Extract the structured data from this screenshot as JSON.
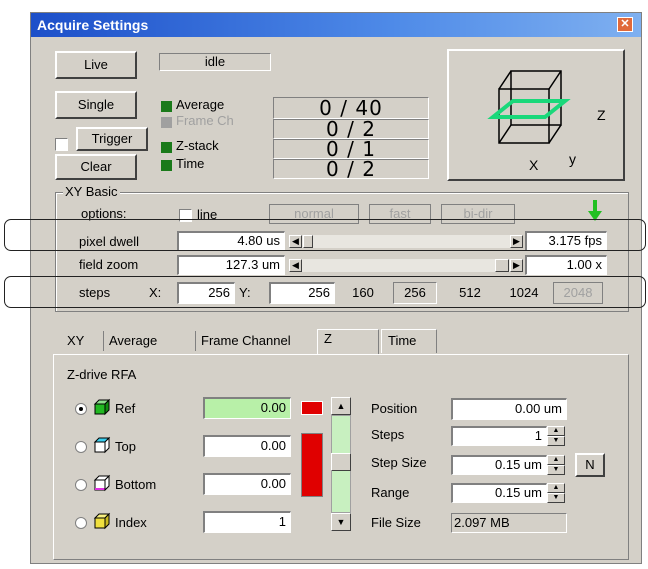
{
  "window": {
    "title": "Acquire Settings",
    "close_glyph": "✕"
  },
  "acquire": {
    "live_label": "Live",
    "single_label": "Single",
    "trigger_label": "Trigger",
    "clear_label": "Clear",
    "status": "idle",
    "counters": [
      {
        "label": "Average",
        "value": "0 / 40",
        "color": "#1a7a1a",
        "enabled": true
      },
      {
        "label": "Frame Ch",
        "value": "0 / 2",
        "color": "#a0a0a0",
        "enabled": false
      },
      {
        "label": "Z-stack",
        "value": "0 / 1",
        "color": "#1a7a1a",
        "enabled": true
      },
      {
        "label": "Time",
        "value": "0 / 2",
        "color": "#1a7a1a",
        "enabled": true
      }
    ]
  },
  "axes_diagram": {
    "x": "X",
    "y": "y",
    "z": "Z"
  },
  "xy_basic": {
    "group_label": "XY Basic",
    "options_label": "options:",
    "line_label": "line",
    "normal_label": "normal",
    "fast_label": "fast",
    "bi_dir_label": "bi-dir",
    "pixel_dwell_label": "pixel dwell",
    "pixel_dwell_value": "4.80 us",
    "fps_value": "3.175 fps",
    "field_zoom_label": "field zoom",
    "field_zoom_value": "127.3 um",
    "zoom_factor": "1.00 x",
    "steps_label": "steps",
    "x_label": "X:",
    "x_value": "256",
    "y_label": "Y:",
    "y_value": "256",
    "step_presets": [
      "160",
      "256",
      "512",
      "1024",
      "2048"
    ]
  },
  "tabs": [
    "XY",
    "Average",
    "Frame Channel",
    "Z",
    "Time"
  ],
  "z_panel": {
    "title": "Z-drive RFA",
    "rows": [
      {
        "label": "Ref",
        "value": "0.00",
        "selected": true
      },
      {
        "label": "Top",
        "value": "0.00",
        "selected": false
      },
      {
        "label": "Bottom",
        "value": "0.00",
        "selected": false
      },
      {
        "label": "Index",
        "value": "1",
        "selected": false
      }
    ],
    "position_label": "Position",
    "position_value": "0.00 um",
    "steps_label": "Steps",
    "steps_value": "1",
    "step_size_label": "Step Size",
    "step_size_value": "0.15 um",
    "n_label": "N",
    "range_label": "Range",
    "range_value": "0.15 um",
    "file_size_label": "File Size",
    "file_size_value": "2.097 MB"
  }
}
